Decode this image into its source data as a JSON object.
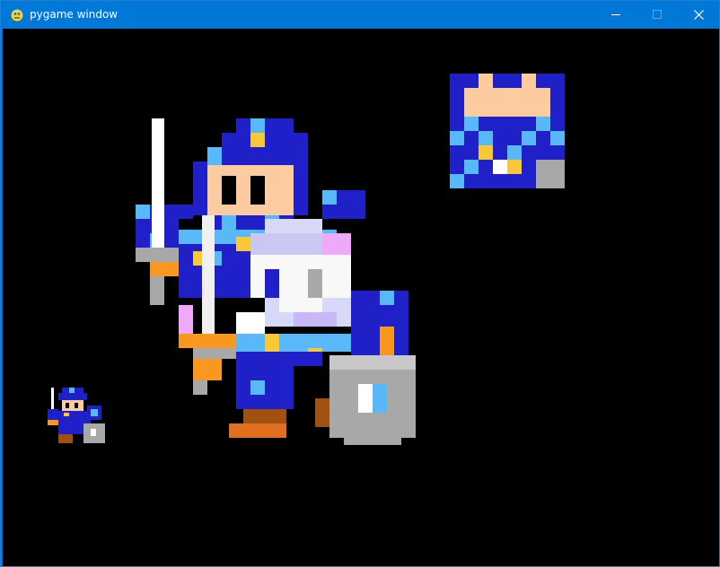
{
  "window": {
    "title": "pygame window",
    "controls": [
      "minimize-icon",
      "maximize-icon",
      "close-icon"
    ]
  },
  "colors": {
    "titlebar": "#0078d7",
    "canvas_background": "#000000",
    "armor_dark_blue": "#2020c8",
    "armor_light_blue": "#58b8f8",
    "skin": "#fccca0",
    "gold": "#f8c838",
    "steel": "#a8a8a8",
    "boots_brown": "#a05010"
  },
  "sprites": [
    {
      "name": "hero-large",
      "kind": "knight with sword and shield"
    },
    {
      "name": "hero-small",
      "kind": "knight with sword and shield"
    },
    {
      "name": "hero-head-crop",
      "kind": "partial sprite tile"
    }
  ]
}
